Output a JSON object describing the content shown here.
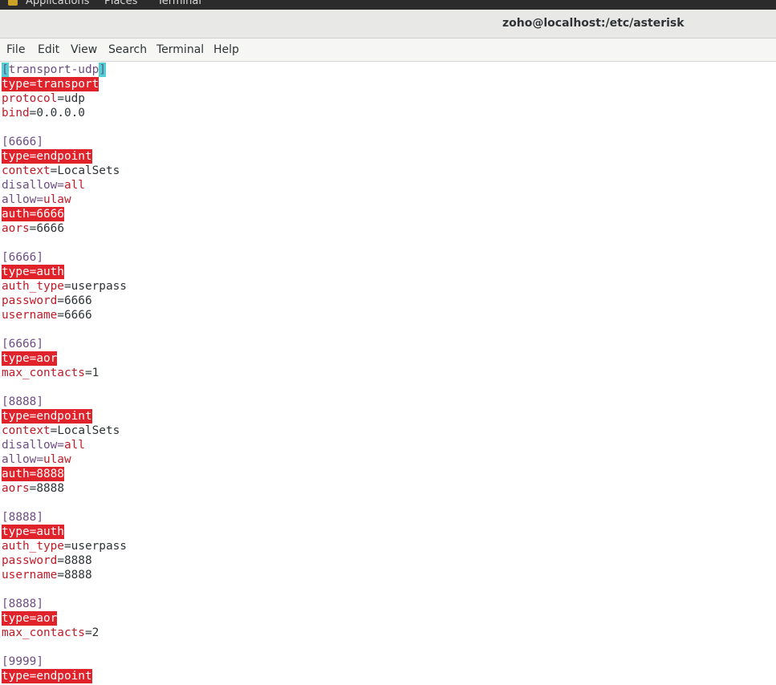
{
  "topbar": {
    "applications": "Applications",
    "places": "Places",
    "terminal": "Terminal"
  },
  "window": {
    "title": "zoho@localhost:/etc/asterisk"
  },
  "menu": {
    "items": [
      "File",
      "Edit",
      "View",
      "Search",
      "Terminal",
      "Help"
    ]
  },
  "terminal": {
    "lines": [
      {
        "kind": "section_cursor",
        "open": "[",
        "name": "transport-udp",
        "close": "]"
      },
      {
        "kind": "highlight",
        "text": "type=transport"
      },
      {
        "kind": "kv",
        "key": "protocol",
        "eq": "=",
        "val": "udp"
      },
      {
        "kind": "kv",
        "key": "bind",
        "eq": "=",
        "val": "0.0.0.0"
      },
      {
        "kind": "blank"
      },
      {
        "kind": "section",
        "text": "[6666]"
      },
      {
        "kind": "highlight",
        "text": "type=endpoint"
      },
      {
        "kind": "kv",
        "key": "context",
        "eq": "=",
        "val": "LocalSets"
      },
      {
        "kind": "purple_kv",
        "key": "disallow=",
        "val": "all"
      },
      {
        "kind": "purple_kv",
        "key": "allow=",
        "val": "ulaw"
      },
      {
        "kind": "highlight",
        "text": "auth=6666"
      },
      {
        "kind": "kv",
        "key": "aors",
        "eq": "=",
        "val": "6666"
      },
      {
        "kind": "blank"
      },
      {
        "kind": "section",
        "text": "[6666]"
      },
      {
        "kind": "highlight",
        "text": "type=auth"
      },
      {
        "kind": "kv",
        "key": "auth_type",
        "eq": "=",
        "val": "userpass"
      },
      {
        "kind": "kv",
        "key": "password",
        "eq": "=",
        "val": "6666"
      },
      {
        "kind": "kv",
        "key": "username",
        "eq": "=",
        "val": "6666"
      },
      {
        "kind": "blank"
      },
      {
        "kind": "section",
        "text": "[6666]"
      },
      {
        "kind": "highlight",
        "text": "type=aor"
      },
      {
        "kind": "kv",
        "key": "max_contacts",
        "eq": "=",
        "val": "1"
      },
      {
        "kind": "blank"
      },
      {
        "kind": "section",
        "text": "[8888]"
      },
      {
        "kind": "highlight",
        "text": "type=endpoint"
      },
      {
        "kind": "kv",
        "key": "context",
        "eq": "=",
        "val": "LocalSets"
      },
      {
        "kind": "purple_kv",
        "key": "disallow=",
        "val": "all"
      },
      {
        "kind": "purple_kv",
        "key": "allow=",
        "val": "ulaw"
      },
      {
        "kind": "highlight",
        "text": "auth=8888"
      },
      {
        "kind": "kv",
        "key": "aors",
        "eq": "=",
        "val": "8888"
      },
      {
        "kind": "blank"
      },
      {
        "kind": "section",
        "text": "[8888]"
      },
      {
        "kind": "highlight",
        "text": "type=auth"
      },
      {
        "kind": "kv",
        "key": "auth_type",
        "eq": "=",
        "val": "userpass"
      },
      {
        "kind": "kv",
        "key": "password",
        "eq": "=",
        "val": "8888"
      },
      {
        "kind": "kv",
        "key": "username",
        "eq": "=",
        "val": "8888"
      },
      {
        "kind": "blank"
      },
      {
        "kind": "section",
        "text": "[8888]"
      },
      {
        "kind": "highlight",
        "text": "type=aor"
      },
      {
        "kind": "kv",
        "key": "max_contacts",
        "eq": "=",
        "val": "2"
      },
      {
        "kind": "blank"
      },
      {
        "kind": "section",
        "text": "[9999]"
      },
      {
        "kind": "highlight",
        "text": "type=endpoint"
      }
    ]
  },
  "colors": {
    "keyword_red": "#c01c28",
    "section_purple": "#6e4d83",
    "highlight_bg": "#e0222a",
    "cursor_bg": "#4fd0d5",
    "text": "#2e3436"
  }
}
